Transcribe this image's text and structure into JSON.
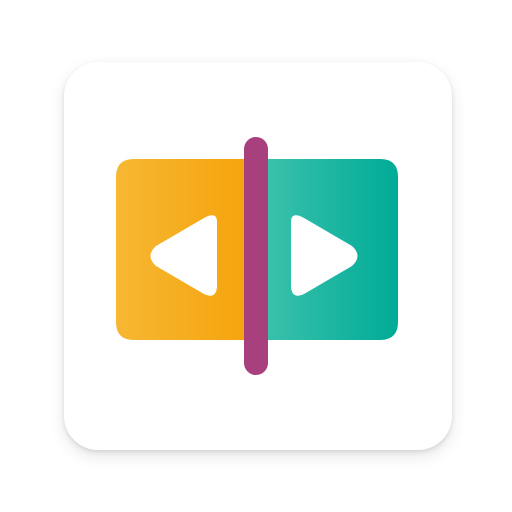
{
  "app_icon": {
    "icon_name": "split-screen-video-player-icon",
    "colors": {
      "tile_background": "#ffffff",
      "left_panel_light": "#f7b733",
      "left_panel_dark": "#f5a30a",
      "right_panel_light": "#3ec3ad",
      "right_panel_dark": "#00ab97",
      "divider": "#a7407d",
      "arrows": "#ffffff"
    },
    "elements": [
      "left-panel",
      "right-panel",
      "divider-bar",
      "left-play-arrow",
      "right-play-arrow"
    ]
  }
}
